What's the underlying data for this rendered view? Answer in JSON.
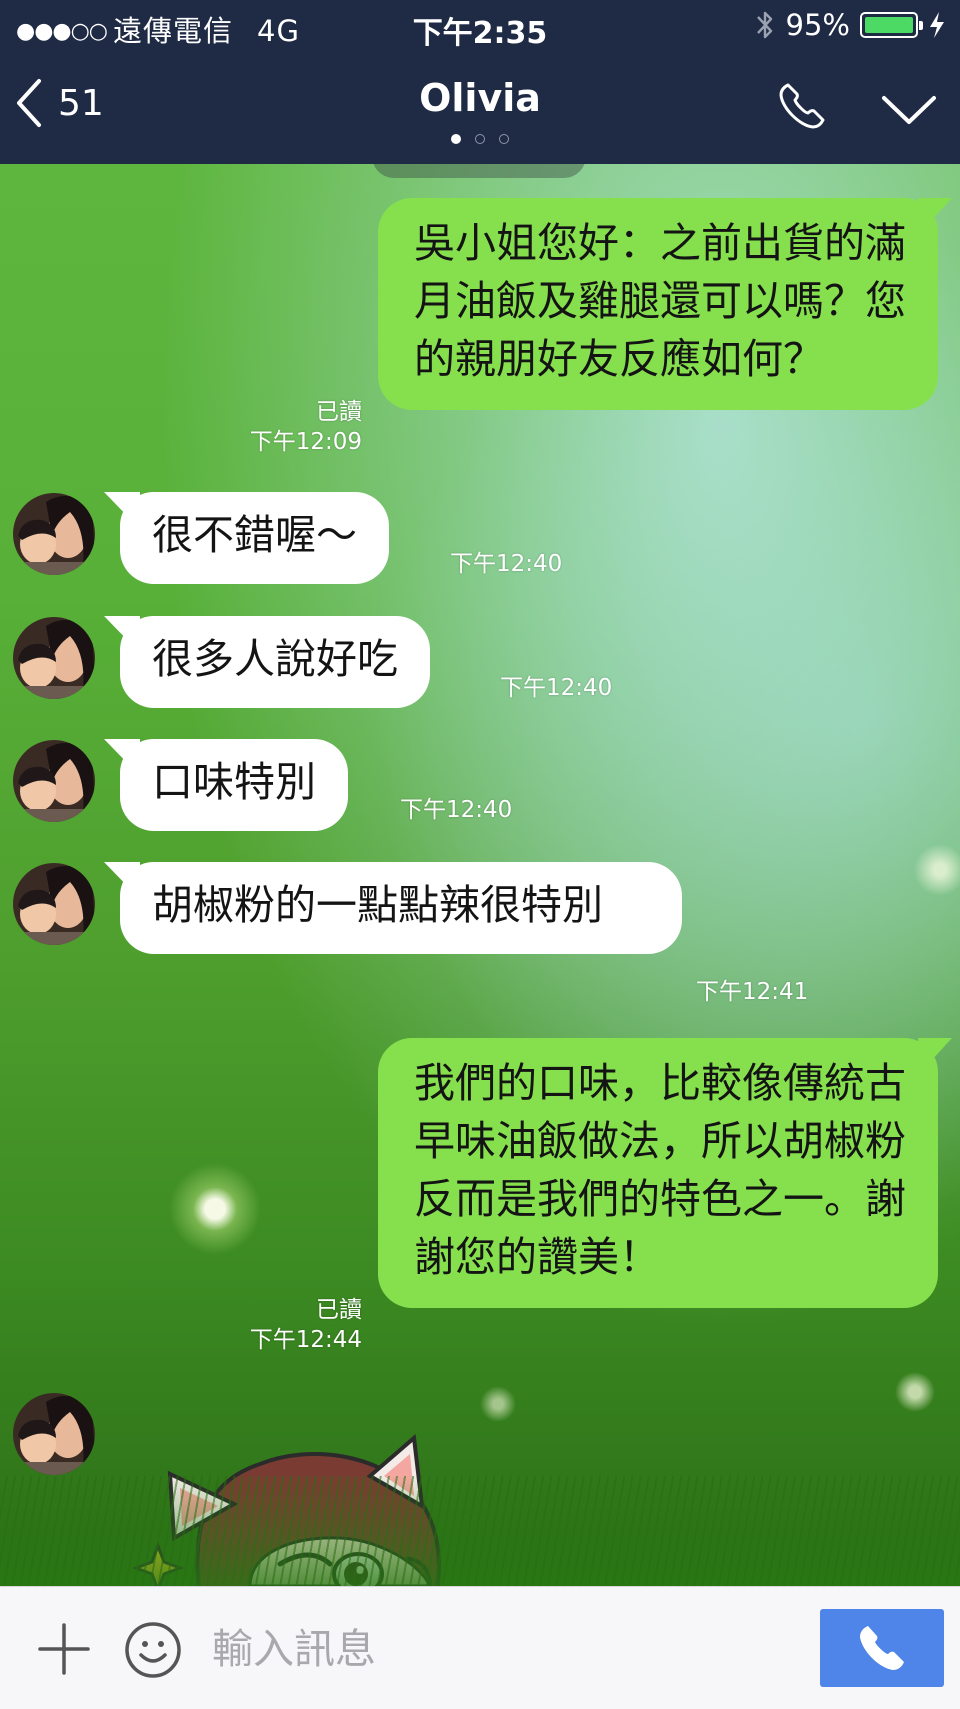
{
  "status_bar": {
    "signal": "●●●○○",
    "carrier": "遠傳電信",
    "network": "4G",
    "time": "下午2:35",
    "battery_percent": "95%",
    "battery_level": 0.95
  },
  "header": {
    "back_count": "51",
    "title": "Olivia",
    "page_count": 3,
    "active_page": 1
  },
  "messages": [
    {
      "side": "out",
      "text": "吳小姐您好：之前出貨的滿月油飯及雞腿還可以嗎？您的親朋好友反應如何？",
      "read": "已讀",
      "time": "下午12:09"
    },
    {
      "side": "in",
      "text": "很不錯喔～",
      "time": "下午12:40"
    },
    {
      "side": "in",
      "text": "很多人說好吃",
      "time": "下午12:40"
    },
    {
      "side": "in",
      "text": "口味特別",
      "time": "下午12:40"
    },
    {
      "side": "in",
      "text": "胡椒粉的一點點辣很特別",
      "time": "下午12:41"
    },
    {
      "side": "out",
      "text": "我們的口味，比較像傳統古早味油飯做法，所以胡椒粉反而是我們的特色之一。謝謝您的讚美！",
      "read": "已讀",
      "time": "下午12:44"
    },
    {
      "side": "in",
      "type": "sticker",
      "icon": "cat-ear-girl-sticker"
    }
  ],
  "input": {
    "placeholder": "輸入訊息"
  },
  "icons": {
    "back": "chevron-left-icon",
    "call": "phone-icon",
    "menu": "chevron-down-icon",
    "add": "plus-icon",
    "emoji": "smiley-icon",
    "voice_call": "phone-icon"
  },
  "colors": {
    "header_bg": "#1f2a45",
    "outgoing_bubble": "#86e04e",
    "incoming_bubble": "#ffffff",
    "call_button": "#4f84e8",
    "battery": "#4cd964"
  }
}
